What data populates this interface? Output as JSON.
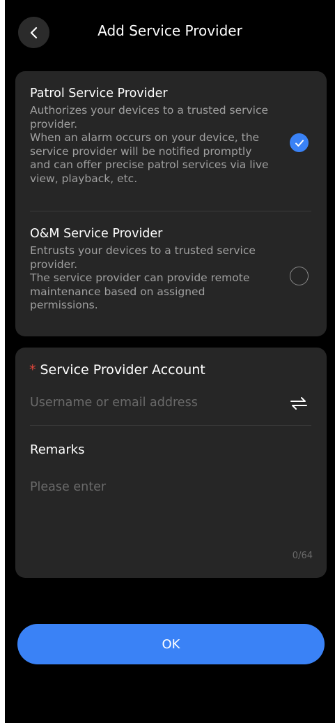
{
  "header": {
    "title": "Add Service Provider",
    "back_icon": "chevron-left-icon"
  },
  "provider_types": [
    {
      "title": "Patrol Service Provider",
      "description": "Authorizes your devices to a trusted service provider.\nWhen an alarm occurs on your device, the service provider will be notified promptly and can offer precise patrol services via live view, playback, etc.",
      "selected": true
    },
    {
      "title": "O&M Service Provider",
      "description": "Entrusts your devices to a trusted service provider.\nThe service provider can provide remote maintenance based on assigned permissions.",
      "selected": false
    }
  ],
  "form": {
    "required_mark": "*",
    "account_label": "Service Provider Account",
    "account_placeholder": "Username or email address",
    "account_value": "",
    "switch_icon": "swap-arrows-icon",
    "remarks_label": "Remarks",
    "remarks_placeholder": "Please enter",
    "remarks_value": "",
    "counter": "0/64"
  },
  "actions": {
    "ok_label": "OK"
  },
  "colors": {
    "background": "#000000",
    "card": "#262626",
    "accent": "#3a82f6",
    "required": "#e5473b",
    "secondary_text": "#a0a0a0",
    "placeholder": "#6a6a6a"
  }
}
